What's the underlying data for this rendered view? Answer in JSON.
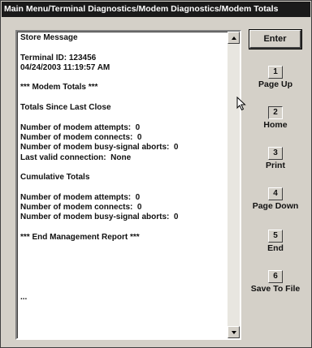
{
  "window": {
    "title": "Main Menu/Terminal Diagnostics/Modem Diagnostics/Modem Totals"
  },
  "report": {
    "lines": [
      "Store Message",
      "",
      "Terminal ID: 123456",
      "04/24/2003 11:19:57 AM",
      "",
      "*** Modem Totals ***",
      "",
      "Totals Since Last Close",
      "",
      "Number of modem attempts:  0",
      "Number of modem connects:  0",
      "Number of modem busy-signal aborts:  0",
      "Last valid connection:  None",
      "",
      "Cumulative Totals",
      "",
      "Number of modem attempts:  0",
      "Number of modem connects:  0",
      "Number of modem busy-signal aborts:  0",
      "",
      "*** End Management Report ***",
      "",
      "",
      "",
      "",
      "",
      "...",
      "",
      "",
      "",
      ""
    ]
  },
  "buttons": {
    "enter_label": "Enter",
    "fkeys": [
      {
        "key": "1",
        "label": "Page Up",
        "pressed": false
      },
      {
        "key": "2",
        "label": "Home",
        "pressed": true
      },
      {
        "key": "3",
        "label": "Print",
        "pressed": false
      },
      {
        "key": "4",
        "label": "Page Down",
        "pressed": false
      },
      {
        "key": "5",
        "label": "End",
        "pressed": false
      },
      {
        "key": "6",
        "label": "Save To File",
        "pressed": false
      }
    ]
  },
  "icons": {
    "scroll_up": "up-arrow-icon",
    "scroll_down": "down-arrow-icon",
    "cursor": "mouse-pointer-icon"
  }
}
